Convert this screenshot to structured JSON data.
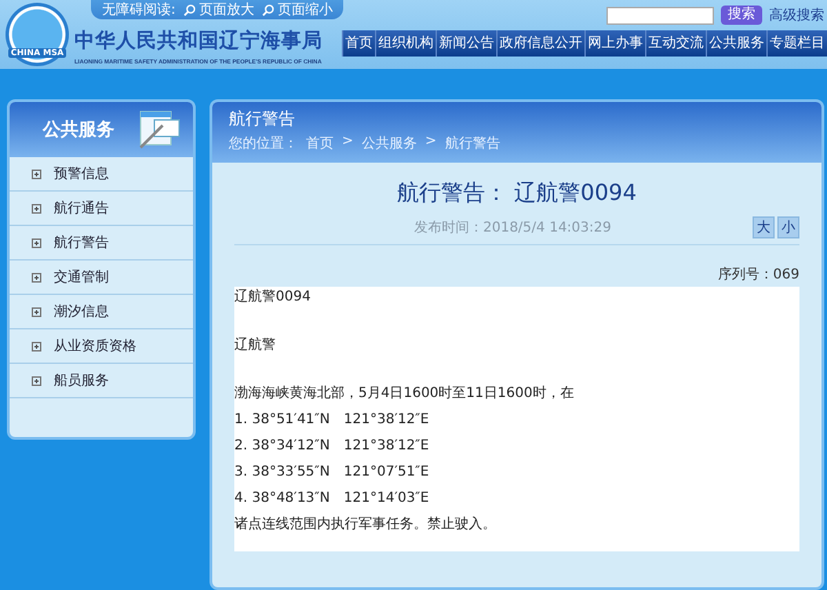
{
  "header": {
    "logo_text": "CHINA MSA",
    "accessibility_label": "无障碍阅读:",
    "accessibility_links": [
      "页面放大",
      "页面缩小"
    ],
    "site_title": "中华人民共和国辽宁海事局",
    "site_subtitle": "LIAONING MARITIME SAFETY ADMINISTRATION OF THE PEOPLE'S REPUBLIC OF CHINA",
    "search_button": "搜索",
    "advanced_search": "高级搜索"
  },
  "nav": [
    "首页",
    "组织机构",
    "新闻公告",
    "政府信息公开",
    "网上办事",
    "互动交流",
    "公共服务",
    "专题栏目"
  ],
  "sidebar": {
    "title": "公共服务",
    "items": [
      {
        "label": "预警信息",
        "expanded": false
      },
      {
        "label": "航行通告",
        "expanded": false
      },
      {
        "label": "航行警告",
        "expanded": false
      },
      {
        "label": "交通管制",
        "expanded": false
      },
      {
        "label": "潮汐信息",
        "expanded": false
      },
      {
        "label": "从业资质资格",
        "expanded": false
      },
      {
        "label": "船员服务",
        "expanded": false
      }
    ]
  },
  "content": {
    "section_title": "航行警告",
    "breadcrumb": [
      "您的位置：",
      "首页",
      ">",
      "公共服务",
      ">",
      "航行警告"
    ],
    "article_title": "航行警告： 辽航警0094",
    "publish_time": "发布时间：2018/5/4 14:03:29",
    "font_buttons": [
      "大",
      "小"
    ],
    "serial": "序列号：069",
    "paragraphs": [
      [
        "辽航警0094"
      ],
      [
        "辽航警"
      ],
      [
        "渤海海峡黄海北部，5月4日1600时至11日1600时，在",
        "1. 38°51′41″N　121°38′12″E",
        "2. 38°34′12″N　121°38′12″E",
        "3. 38°33′55″N　121°07′51″E",
        "4. 38°48′13″N　121°14′03″E",
        "诸点连线范围内执行军事任务。禁止驶入。"
      ]
    ]
  }
}
